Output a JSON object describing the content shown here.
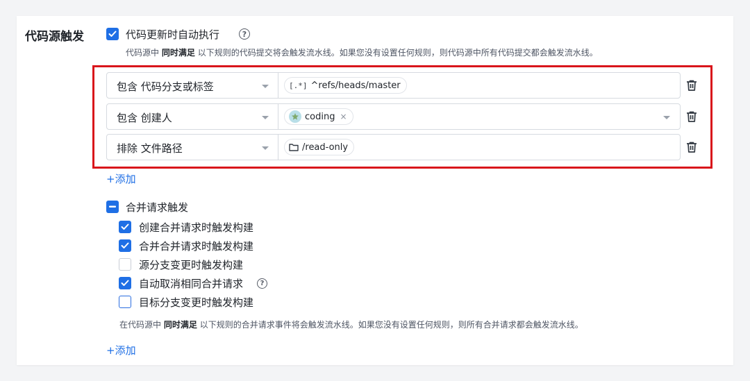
{
  "section_title": "代码源触发",
  "push_trigger": {
    "label": "代码更新时自动执行",
    "checked": true,
    "description_prefix": "代码源中",
    "description_bold": "同时满足",
    "description_suffix": "以下规则的代码提交将会触发流水线。如果您没有设置任何规则，则代码源中所有代码提交都会触发流水线。"
  },
  "rules": [
    {
      "condition": "包含 代码分支或标签",
      "value_icon": "regex-icon",
      "value_prefix": "[.*]",
      "value": "^refs/heads/master"
    },
    {
      "condition": "包含 创建人",
      "value_icon": "user-avatar",
      "value": "coding",
      "removable": "×"
    },
    {
      "condition": "排除 文件路径",
      "value_icon": "folder-icon",
      "value": "/read-only"
    }
  ],
  "add_rule_label": "+添加",
  "mr_trigger": {
    "label": "合并请求触发",
    "state": "indeterminate",
    "options": [
      {
        "label": "创建合并请求时触发构建",
        "checked": true
      },
      {
        "label": "合并合并请求时触发构建",
        "checked": true
      },
      {
        "label": "源分支变更时触发构建",
        "checked": false
      },
      {
        "label": "自动取消相同合并请求",
        "checked": true,
        "help": "?"
      },
      {
        "label": "目标分支变更时触发构建",
        "checked": false
      }
    ],
    "description_prefix": "在代码源中",
    "description_bold": "同时满足",
    "description_suffix": "以下规则的合并请求事件将会触发流水线。如果您没有设置任何规则，则所有合并请求都会触发流水线。",
    "add_rule_label": "+添加"
  },
  "colors": {
    "primary": "#1f6fe5",
    "highlight_border": "#d9151b"
  }
}
